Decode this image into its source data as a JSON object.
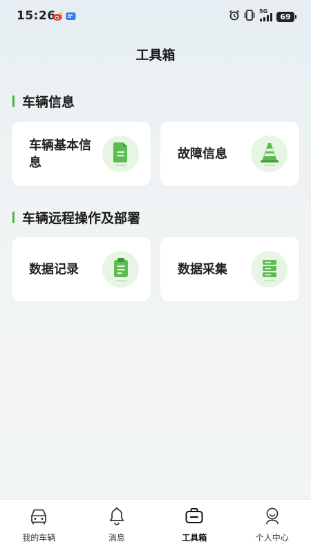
{
  "status_bar": {
    "time": "15:26",
    "network": "5G",
    "battery": "69",
    "icons": [
      "weibo-icon",
      "message-app-icon",
      "alarm-icon",
      "vibrate-icon",
      "signal-icon",
      "battery-icon"
    ]
  },
  "header": {
    "title": "工具箱"
  },
  "sections": [
    {
      "title": "车辆信息",
      "cards": [
        {
          "label": "车辆基本信息",
          "icon": "document-icon"
        },
        {
          "label": "故障信息",
          "icon": "traffic-cone-icon"
        }
      ]
    },
    {
      "title": "车辆远程操作及部署",
      "cards": [
        {
          "label": "数据记录",
          "icon": "clipboard-icon"
        },
        {
          "label": "数据采集",
          "icon": "database-icon"
        }
      ]
    }
  ],
  "tab_bar": {
    "active": "工具箱",
    "items": [
      {
        "label": "我的车辆",
        "icon": "car-icon"
      },
      {
        "label": "消息",
        "icon": "bell-icon"
      },
      {
        "label": "工具箱",
        "icon": "toolbox-icon"
      },
      {
        "label": "个人中心",
        "icon": "user-center-icon"
      }
    ]
  },
  "colors": {
    "accent": "#4caf50",
    "icon_bg": "#e7f5e4",
    "card_bg": "#ffffff"
  }
}
